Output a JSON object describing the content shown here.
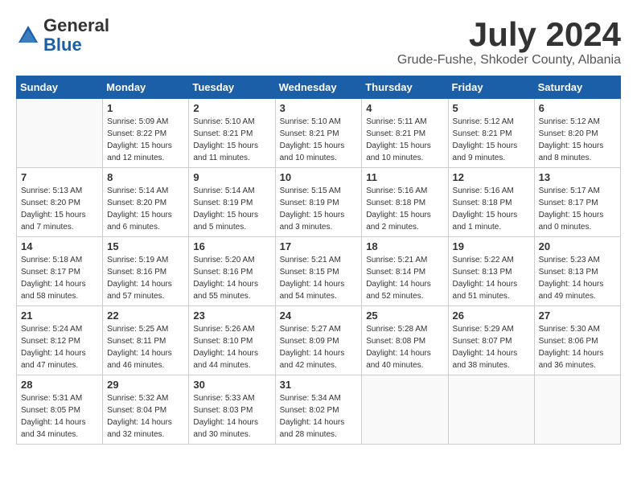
{
  "header": {
    "logo_general": "General",
    "logo_blue": "Blue",
    "month_title": "July 2024",
    "location": "Grude-Fushe, Shkoder County, Albania"
  },
  "weekdays": [
    "Sunday",
    "Monday",
    "Tuesday",
    "Wednesday",
    "Thursday",
    "Friday",
    "Saturday"
  ],
  "weeks": [
    [
      {
        "day": "",
        "info": ""
      },
      {
        "day": "1",
        "info": "Sunrise: 5:09 AM\nSunset: 8:22 PM\nDaylight: 15 hours\nand 12 minutes."
      },
      {
        "day": "2",
        "info": "Sunrise: 5:10 AM\nSunset: 8:21 PM\nDaylight: 15 hours\nand 11 minutes."
      },
      {
        "day": "3",
        "info": "Sunrise: 5:10 AM\nSunset: 8:21 PM\nDaylight: 15 hours\nand 10 minutes."
      },
      {
        "day": "4",
        "info": "Sunrise: 5:11 AM\nSunset: 8:21 PM\nDaylight: 15 hours\nand 10 minutes."
      },
      {
        "day": "5",
        "info": "Sunrise: 5:12 AM\nSunset: 8:21 PM\nDaylight: 15 hours\nand 9 minutes."
      },
      {
        "day": "6",
        "info": "Sunrise: 5:12 AM\nSunset: 8:20 PM\nDaylight: 15 hours\nand 8 minutes."
      }
    ],
    [
      {
        "day": "7",
        "info": "Sunrise: 5:13 AM\nSunset: 8:20 PM\nDaylight: 15 hours\nand 7 minutes."
      },
      {
        "day": "8",
        "info": "Sunrise: 5:14 AM\nSunset: 8:20 PM\nDaylight: 15 hours\nand 6 minutes."
      },
      {
        "day": "9",
        "info": "Sunrise: 5:14 AM\nSunset: 8:19 PM\nDaylight: 15 hours\nand 5 minutes."
      },
      {
        "day": "10",
        "info": "Sunrise: 5:15 AM\nSunset: 8:19 PM\nDaylight: 15 hours\nand 3 minutes."
      },
      {
        "day": "11",
        "info": "Sunrise: 5:16 AM\nSunset: 8:18 PM\nDaylight: 15 hours\nand 2 minutes."
      },
      {
        "day": "12",
        "info": "Sunrise: 5:16 AM\nSunset: 8:18 PM\nDaylight: 15 hours\nand 1 minute."
      },
      {
        "day": "13",
        "info": "Sunrise: 5:17 AM\nSunset: 8:17 PM\nDaylight: 15 hours\nand 0 minutes."
      }
    ],
    [
      {
        "day": "14",
        "info": "Sunrise: 5:18 AM\nSunset: 8:17 PM\nDaylight: 14 hours\nand 58 minutes."
      },
      {
        "day": "15",
        "info": "Sunrise: 5:19 AM\nSunset: 8:16 PM\nDaylight: 14 hours\nand 57 minutes."
      },
      {
        "day": "16",
        "info": "Sunrise: 5:20 AM\nSunset: 8:16 PM\nDaylight: 14 hours\nand 55 minutes."
      },
      {
        "day": "17",
        "info": "Sunrise: 5:21 AM\nSunset: 8:15 PM\nDaylight: 14 hours\nand 54 minutes."
      },
      {
        "day": "18",
        "info": "Sunrise: 5:21 AM\nSunset: 8:14 PM\nDaylight: 14 hours\nand 52 minutes."
      },
      {
        "day": "19",
        "info": "Sunrise: 5:22 AM\nSunset: 8:13 PM\nDaylight: 14 hours\nand 51 minutes."
      },
      {
        "day": "20",
        "info": "Sunrise: 5:23 AM\nSunset: 8:13 PM\nDaylight: 14 hours\nand 49 minutes."
      }
    ],
    [
      {
        "day": "21",
        "info": "Sunrise: 5:24 AM\nSunset: 8:12 PM\nDaylight: 14 hours\nand 47 minutes."
      },
      {
        "day": "22",
        "info": "Sunrise: 5:25 AM\nSunset: 8:11 PM\nDaylight: 14 hours\nand 46 minutes."
      },
      {
        "day": "23",
        "info": "Sunrise: 5:26 AM\nSunset: 8:10 PM\nDaylight: 14 hours\nand 44 minutes."
      },
      {
        "day": "24",
        "info": "Sunrise: 5:27 AM\nSunset: 8:09 PM\nDaylight: 14 hours\nand 42 minutes."
      },
      {
        "day": "25",
        "info": "Sunrise: 5:28 AM\nSunset: 8:08 PM\nDaylight: 14 hours\nand 40 minutes."
      },
      {
        "day": "26",
        "info": "Sunrise: 5:29 AM\nSunset: 8:07 PM\nDaylight: 14 hours\nand 38 minutes."
      },
      {
        "day": "27",
        "info": "Sunrise: 5:30 AM\nSunset: 8:06 PM\nDaylight: 14 hours\nand 36 minutes."
      }
    ],
    [
      {
        "day": "28",
        "info": "Sunrise: 5:31 AM\nSunset: 8:05 PM\nDaylight: 14 hours\nand 34 minutes."
      },
      {
        "day": "29",
        "info": "Sunrise: 5:32 AM\nSunset: 8:04 PM\nDaylight: 14 hours\nand 32 minutes."
      },
      {
        "day": "30",
        "info": "Sunrise: 5:33 AM\nSunset: 8:03 PM\nDaylight: 14 hours\nand 30 minutes."
      },
      {
        "day": "31",
        "info": "Sunrise: 5:34 AM\nSunset: 8:02 PM\nDaylight: 14 hours\nand 28 minutes."
      },
      {
        "day": "",
        "info": ""
      },
      {
        "day": "",
        "info": ""
      },
      {
        "day": "",
        "info": ""
      }
    ]
  ]
}
